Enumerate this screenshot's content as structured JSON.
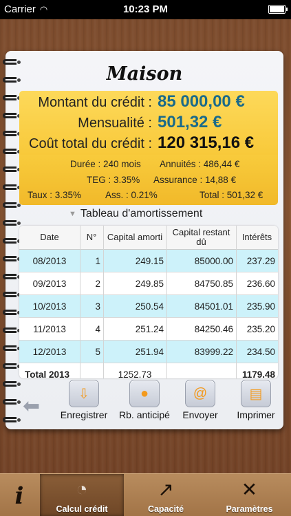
{
  "status_bar": {
    "carrier": "Carrier",
    "time": "10:23 PM"
  },
  "title": "Maison",
  "summary": [
    {
      "label": "Montant du crédit :",
      "value": "85 000,00 €"
    },
    {
      "label": "Mensualité :",
      "value": "501,32 €"
    },
    {
      "label": "Coût total du crédit :",
      "value": "120 315,16 €"
    }
  ],
  "details": {
    "duree": "Durée : 240 mois",
    "annuites": "Annuités : 486,44 €",
    "teg": "TEG : 3.35%",
    "assurance": "Assurance : 14,88 €",
    "taux": "Taux : 3.35%",
    "ass": "Ass. : 0.21%",
    "total": "Total : 501,32 €"
  },
  "table": {
    "title": "Tableau d'amortissement",
    "headers": [
      "Date",
      "N°",
      "Capital amorti",
      "Capital restant dû",
      "Intérêts"
    ],
    "rows": [
      [
        "08/2013",
        "1",
        "249.15",
        "85000.00",
        "237.29"
      ],
      [
        "09/2013",
        "2",
        "249.85",
        "84750.85",
        "236.60"
      ],
      [
        "10/2013",
        "3",
        "250.54",
        "84501.01",
        "235.90"
      ],
      [
        "11/2013",
        "4",
        "251.24",
        "84250.46",
        "235.20"
      ],
      [
        "12/2013",
        "5",
        "251.94",
        "83999.22",
        "234.50"
      ]
    ],
    "total": [
      "Total 2013",
      "",
      "1252.73",
      "",
      "1179.48"
    ]
  },
  "actions": [
    {
      "label": "Enregistrer",
      "icon": "save-icon"
    },
    {
      "label": "Rb. anticipé",
      "icon": "piggy-bank-icon"
    },
    {
      "label": "Envoyer",
      "icon": "email-icon"
    },
    {
      "label": "Imprimer",
      "icon": "printer-icon"
    }
  ],
  "tabs": [
    {
      "label": "",
      "icon": "info-icon"
    },
    {
      "label": "Calcul crédit",
      "icon": "pie-chart-icon"
    },
    {
      "label": "Capacité",
      "icon": "growth-chart-icon"
    },
    {
      "label": "Paramètres",
      "icon": "tools-icon"
    }
  ],
  "colors": {
    "accent_value": "#1a6a8a",
    "summary_bg": "#fdd95a",
    "row_highlight": "#cdf2fa"
  }
}
